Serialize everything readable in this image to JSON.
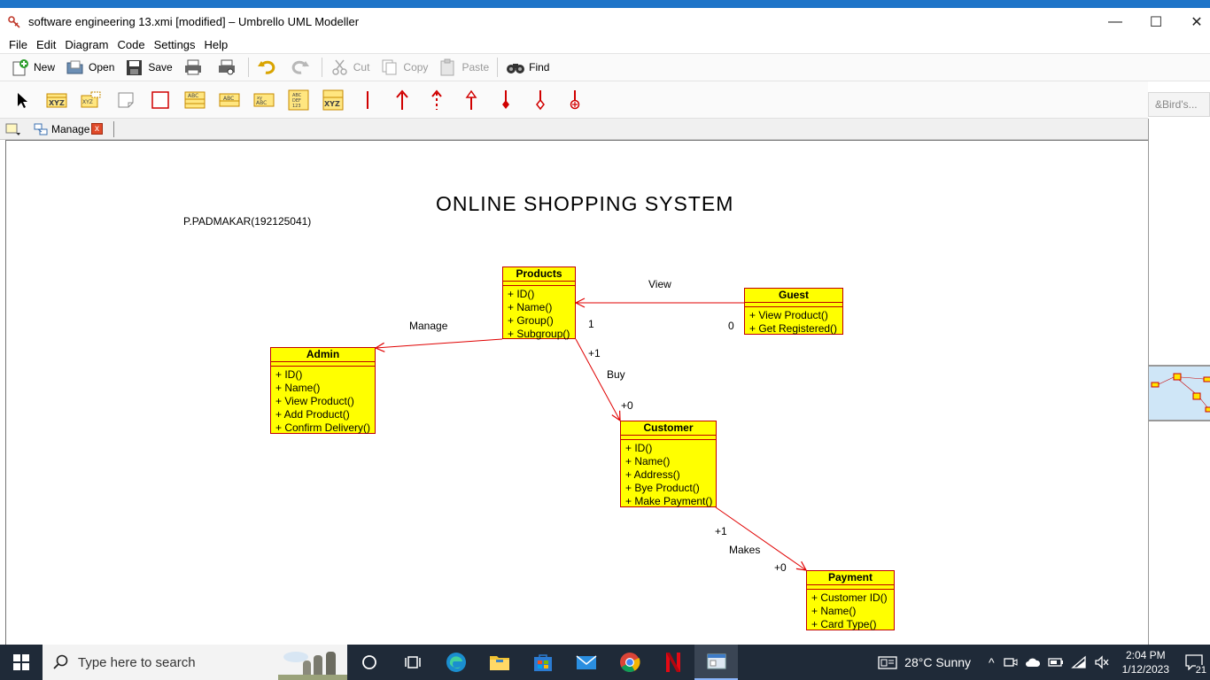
{
  "window": {
    "title": "software engineering 13.xmi [modified] – Umbrello UML Modeller",
    "minimize": "—",
    "maximize": "☐",
    "close": "✕"
  },
  "menubar": [
    "File",
    "Edit",
    "Diagram",
    "Code",
    "Settings",
    "Help"
  ],
  "toolbar": {
    "new": "New",
    "open": "Open",
    "save": "Save",
    "cut": "Cut",
    "copy": "Copy",
    "paste": "Paste",
    "find": "Find"
  },
  "tab": {
    "label": "Manage",
    "close": "x"
  },
  "birdseye": {
    "label": "&Bird's..."
  },
  "diagram": {
    "title": "ONLINE SHOPPING SYSTEM",
    "author": "P.PADMAKAR(192125041)",
    "classes": {
      "products": {
        "name": "Products",
        "ops": [
          "+ ID()",
          "+ Name()",
          "+ Group()",
          "+ Subgroup()"
        ]
      },
      "guest": {
        "name": "Guest",
        "ops": [
          "+ View Product()",
          "+ Get Registered()"
        ]
      },
      "admin": {
        "name": "Admin",
        "ops": [
          "+ ID()",
          "+ Name()",
          "+ View Product()",
          "+ Add Product()",
          "+ Confirm Delivery()"
        ]
      },
      "customer": {
        "name": "Customer",
        "ops": [
          "+ ID()",
          "+ Name()",
          "+ Address()",
          "+ Bye Product()",
          "+ Make Payment()"
        ]
      },
      "payment": {
        "name": "Payment",
        "ops": [
          "+ Customer ID()",
          "+ Name()",
          "+ Card Type()"
        ]
      }
    },
    "labels": {
      "view": "View",
      "view_from": "0",
      "view_to": "1",
      "manage": "Manage",
      "buy": "Buy",
      "buy_from": "+1",
      "buy_to": "+0",
      "makes": "Makes",
      "makes_from": "+1",
      "makes_to": "+0"
    },
    "line_color": "#e00000",
    "class_fill": "#ffff00"
  },
  "taskbar": {
    "search_placeholder": "Type here to search",
    "weather": "28°C  Sunny",
    "time": "2:04 PM",
    "date": "1/12/2023",
    "notifications": "21"
  }
}
